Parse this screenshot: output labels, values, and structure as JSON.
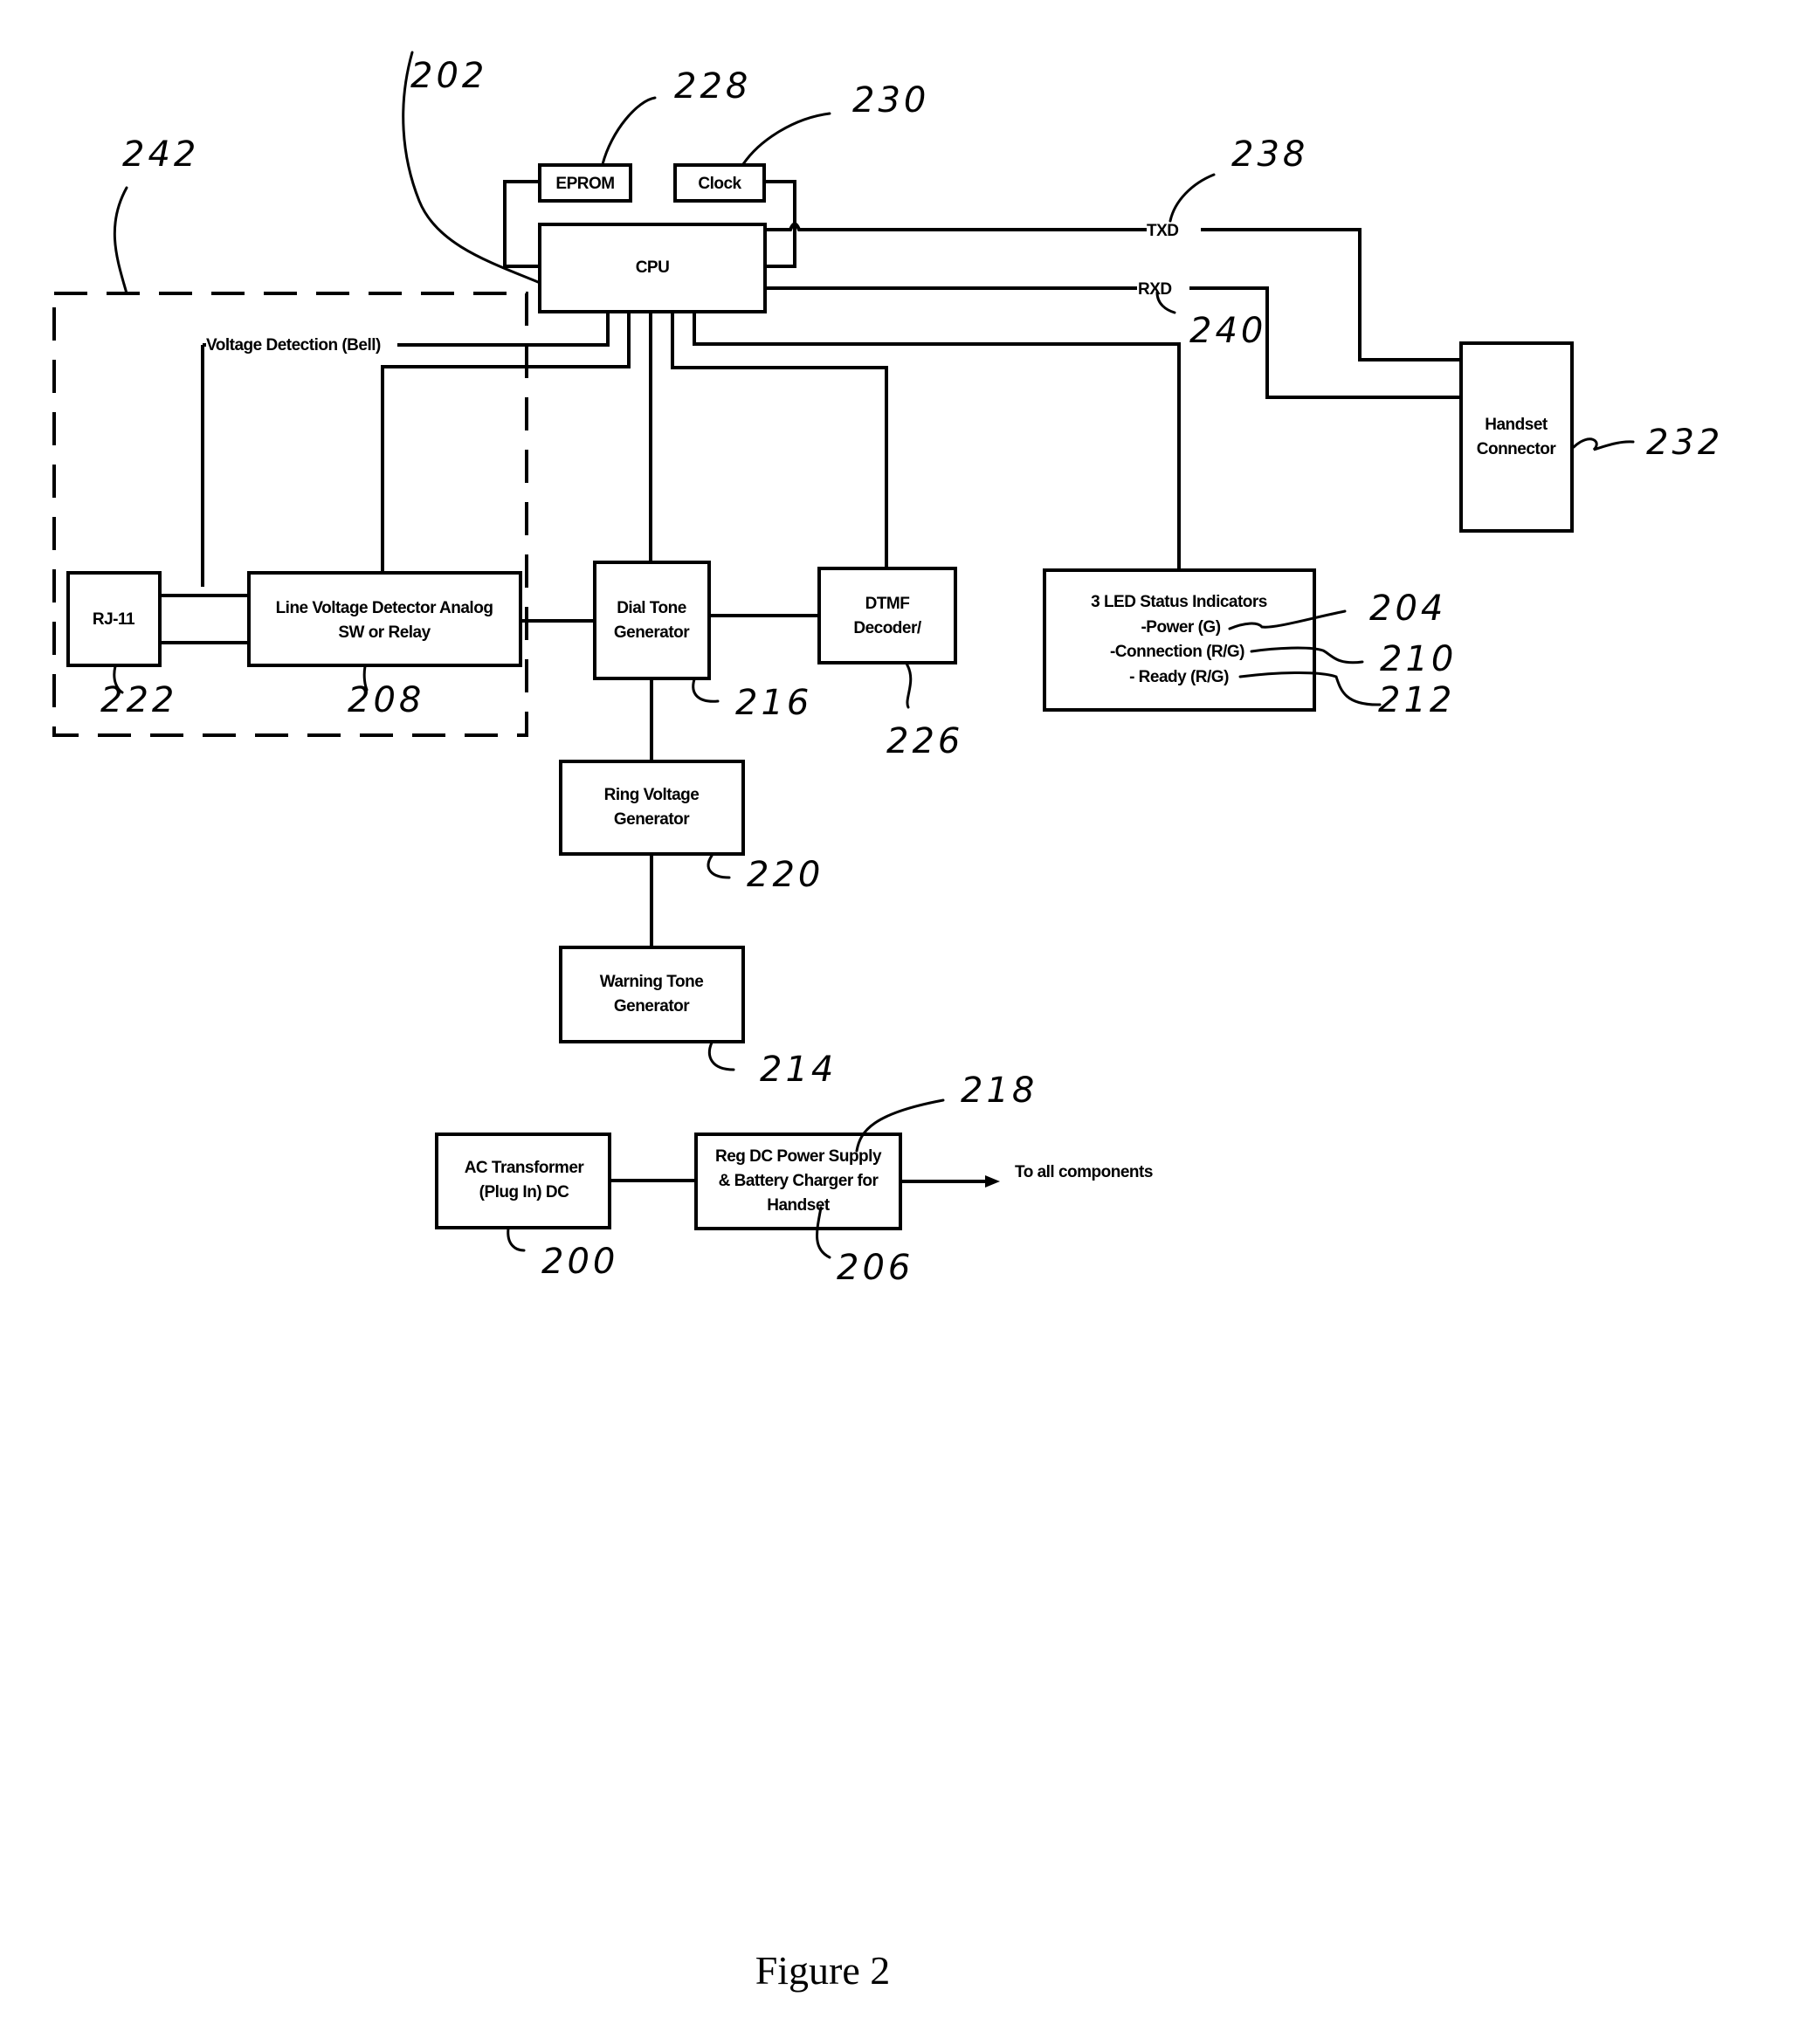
{
  "figure": {
    "caption": "Figure 2"
  },
  "blocks": {
    "eprom": {
      "label": "EPROM",
      "ref": "228"
    },
    "clock": {
      "label": "Clock",
      "ref": "230"
    },
    "cpu": {
      "label": "CPU",
      "ref": "202"
    },
    "rj11": {
      "label": "RJ-11",
      "ref": "222"
    },
    "line_voltage_detector": {
      "line1": "Line Voltage Detector Analog",
      "line2": "SW or Relay",
      "ref": "208"
    },
    "dial_tone_generator": {
      "line1": "Dial Tone",
      "line2": "Generator",
      "ref": "216"
    },
    "dtmf_decoder": {
      "line1": "DTMF",
      "line2": "Decoder/",
      "ref": "226"
    },
    "led_status": {
      "title": "3 LED Status Indicators",
      "items": [
        {
          "label": "-Power (G)",
          "ref": "204"
        },
        {
          "label": "-Connection (R/G)",
          "ref": "210"
        },
        {
          "label": "- Ready (R/G)",
          "ref": "212"
        }
      ]
    },
    "handset_connector": {
      "line1": "Handset",
      "line2": "Connector",
      "ref": "232"
    },
    "ring_voltage_generator": {
      "line1": "Ring Voltage",
      "line2": "Generator",
      "ref": "220"
    },
    "warning_tone_generator": {
      "line1": "Warning Tone",
      "line2": "Generator",
      "ref": "214"
    },
    "ac_transformer": {
      "line1": "AC Transformer",
      "line2": "(Plug In) DC",
      "ref": "200"
    },
    "reg_dc_power_supply": {
      "line1": "Reg DC Power Supply",
      "line2": "& Battery Charger for",
      "line3": "Handset",
      "ref": "206",
      "ref2": "218"
    }
  },
  "signals": {
    "txd": {
      "label": "TXD",
      "ref": "238"
    },
    "rxd": {
      "label": "RXD",
      "ref": "240"
    },
    "voltage_detection": {
      "label": "Voltage Detection (Bell)"
    },
    "to_all_components": {
      "label": "To all components"
    }
  },
  "groups": {
    "line_interface": {
      "ref": "242"
    }
  }
}
